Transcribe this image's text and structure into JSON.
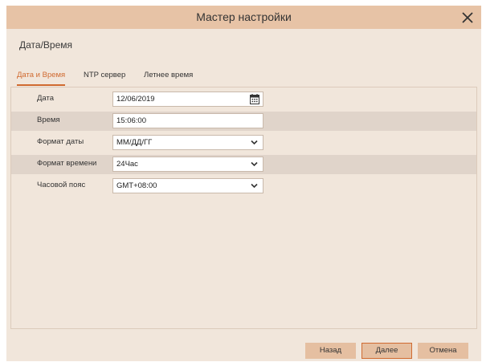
{
  "window": {
    "title": "Мастер настройки"
  },
  "section": {
    "title": "Дата/Время"
  },
  "tabs": [
    {
      "label": "Дата и Время",
      "active": true
    },
    {
      "label": "NTP сервер",
      "active": false
    },
    {
      "label": "Летнее время",
      "active": false
    }
  ],
  "form": {
    "date": {
      "label": "Дата",
      "value": "12/06/2019",
      "icon": "calendar-icon"
    },
    "time": {
      "label": "Время",
      "value": "15:06:00"
    },
    "date_format": {
      "label": "Формат даты",
      "value": "ММ/ДД/ГГ"
    },
    "time_format": {
      "label": "Формат времени",
      "value": "24Час"
    },
    "timezone": {
      "label": "Часовой пояс",
      "value": "GMT+08:00"
    }
  },
  "footer": {
    "back_label": "Назад",
    "next_label": "Далее",
    "cancel_label": "Отмена"
  },
  "colors": {
    "titlebar": "#e7c3a6",
    "background": "#f1e6db",
    "accent": "#d06a30",
    "row_shaded": "#e0d4ca",
    "button": "#e5bfa1"
  }
}
